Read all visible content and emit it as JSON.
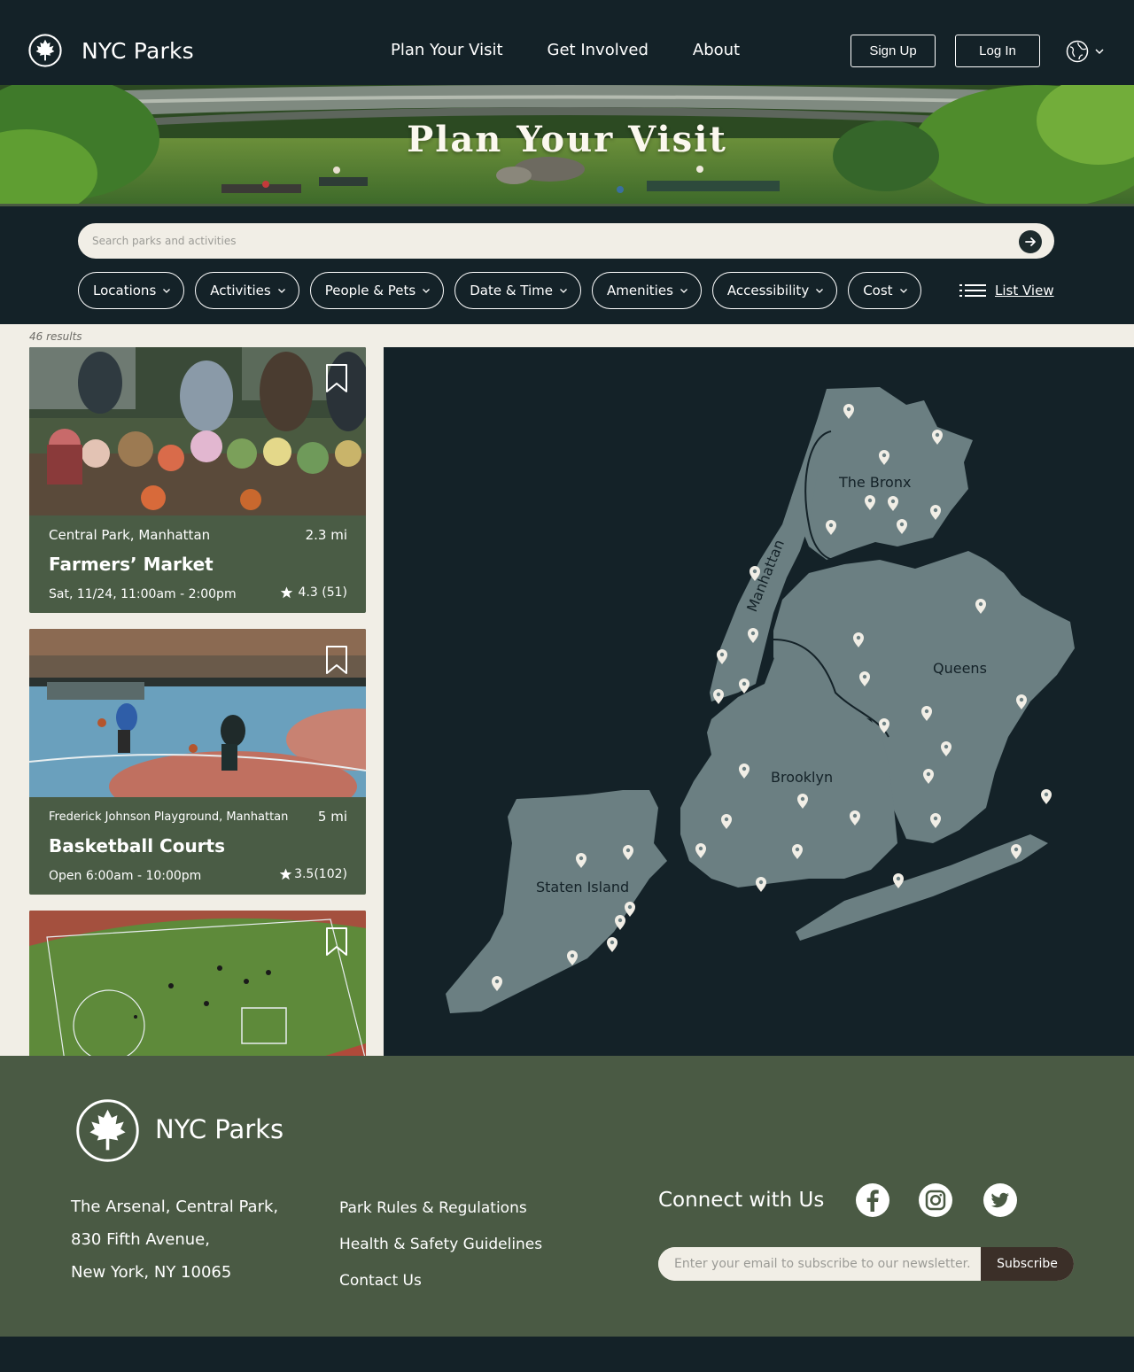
{
  "header": {
    "brand": "NYC Parks",
    "nav": [
      "Plan Your Visit",
      "Get Involved",
      "About"
    ],
    "signup": "Sign Up",
    "login": "Log In"
  },
  "hero": {
    "title": "Plan Your Visit"
  },
  "search": {
    "placeholder": "Search parks and activities"
  },
  "filters": [
    "Locations",
    "Activities",
    "People & Pets",
    "Date & Time",
    "Amenities",
    "Accessibility",
    "Cost"
  ],
  "list_view": "List View",
  "results": {
    "count": "46 results",
    "cards": [
      {
        "location": "Central Park, Manhattan",
        "distance": "2.3 mi",
        "title": "Farmers’ Market",
        "time": "Sat, 11/24, 11:00am - 2:00pm",
        "rating": "4.3 (51)"
      },
      {
        "location": "Frederick Johnson Playground, Manhattan",
        "distance": "5 mi",
        "title": "Basketball Courts",
        "time": "Open 6:00am - 10:00pm",
        "rating": "3.5(102)"
      }
    ]
  },
  "map": {
    "boroughs": [
      "The Bronx",
      "Manhattan",
      "Queens",
      "Brooklyn",
      "Staten Island"
    ]
  },
  "footer": {
    "brand": "NYC Parks",
    "address": [
      "The Arsenal, Central Park,",
      "830 Fifth Avenue,",
      "New York, NY 10065"
    ],
    "links": [
      "Park Rules & Regulations",
      "Health & Safety Guidelines",
      "Contact Us"
    ],
    "connect": "Connect with Us",
    "newsletter_placeholder": "Enter your email to subscribe to our newsletter.",
    "subscribe": "Subscribe"
  },
  "colors": {
    "dark": "#142228",
    "green": "#4a5c45",
    "cream": "#f1eee6",
    "land": "#6b7f82",
    "subscribe": "#3b2f28"
  }
}
